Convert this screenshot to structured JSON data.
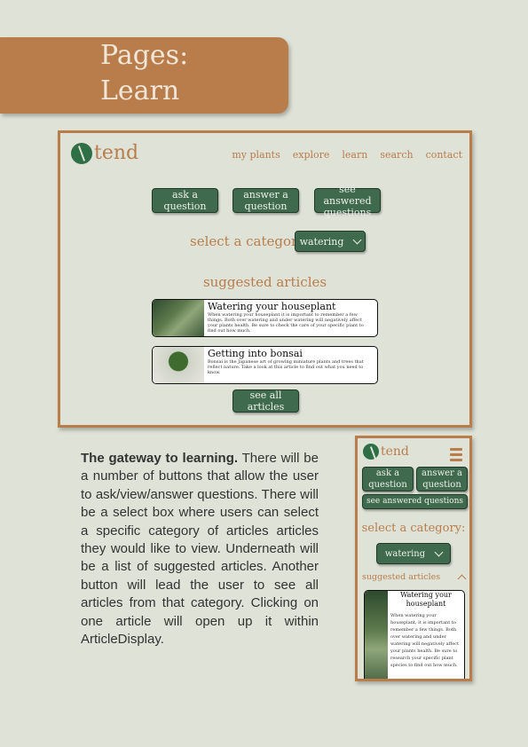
{
  "banner": {
    "line1": "Pages:",
    "line2": "Learn"
  },
  "desktop": {
    "logo_text": "tend",
    "nav": [
      "my plants",
      "explore",
      "learn",
      "search",
      "contact"
    ],
    "buttons": [
      "ask a question",
      "answer a question",
      "see answered questions"
    ],
    "category_label": "select a category:",
    "category_value": "watering",
    "suggested_heading": "suggested articles",
    "articles": [
      {
        "title": "Watering your houseplant",
        "excerpt": "When watering your houseplant it is important to remember a few things. Both over watering and under watering will negatively affect your plants health. Be sure to check the care of your specific plant to find out how much."
      },
      {
        "title": "Getting into bonsai",
        "excerpt": "Bonsai is the Japanese art of growing miniature plants and trees that reflect nature. Take a look at this article to find out what you need to know."
      }
    ],
    "see_all": "see all articles"
  },
  "description": {
    "lead": "The gateway to learning.",
    "body": " There will be a number of buttons that allow the user to ask/view/answer questions. There will be a select box where users can select a specific category of articles articles they would like to view. Underneath will be a list of suggested articles. Another button will lead the user to see all articles from that category. Clicking on one article will open up it within ArticleDisplay."
  },
  "mobile": {
    "logo_text": "tend",
    "buttons": [
      "ask a question",
      "answer a question"
    ],
    "see_answered": "see answered questions",
    "category_label": "select a category:",
    "category_value": "watering",
    "suggested_heading": "suggested articles",
    "article_title": "Watering your houseplant",
    "article_excerpt": "When watering your houseplant, it is important to remember a few things. Both over watering and under watering will negatively affect your plants health. Be sure to research your specific plant species to find out how much."
  },
  "colors": {
    "accent": "#b97d4b",
    "green": "#3f6a4e",
    "background": "#dfe2d7"
  }
}
